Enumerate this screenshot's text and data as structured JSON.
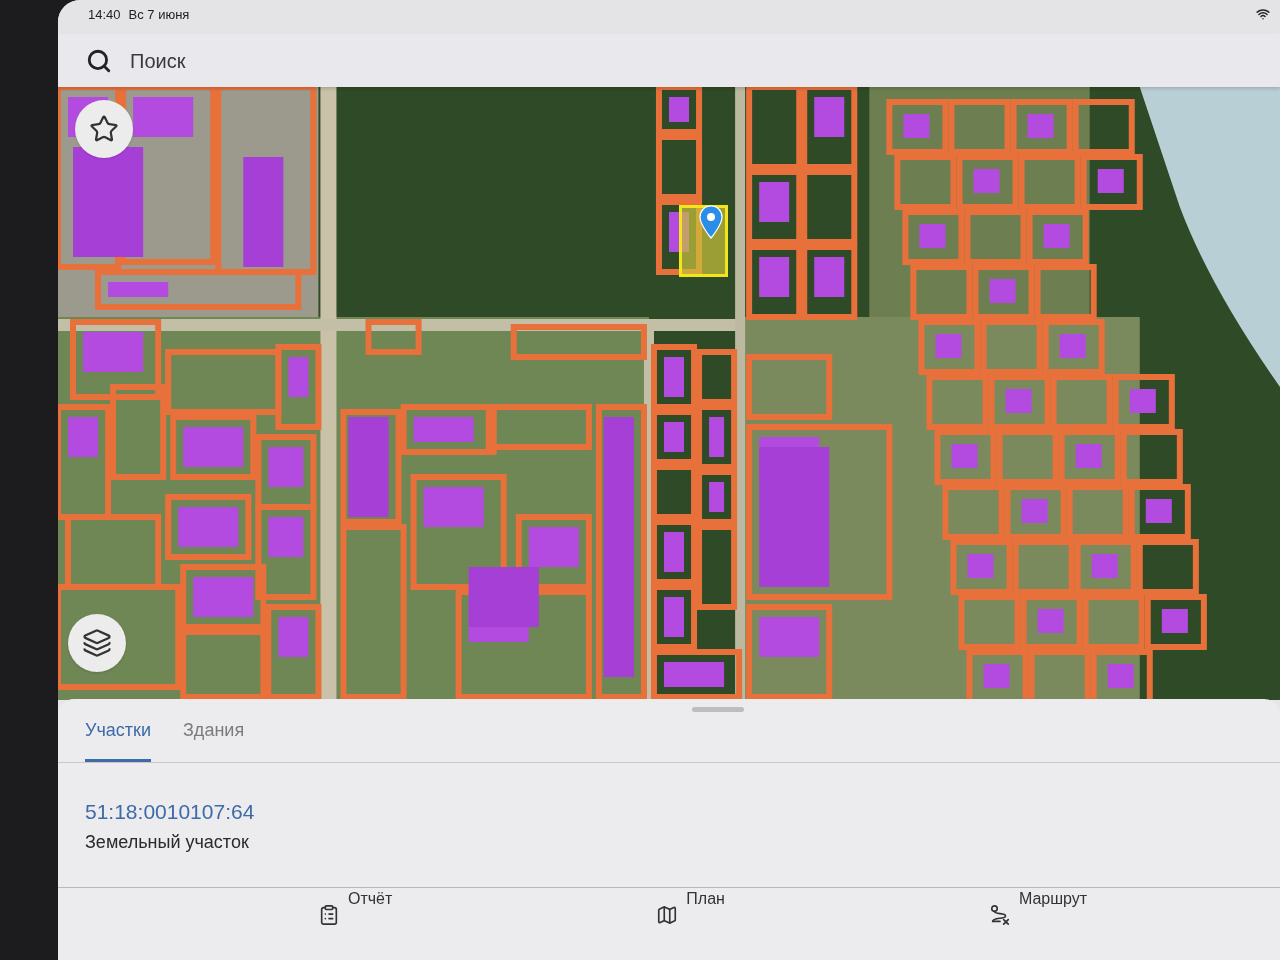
{
  "status_bar": {
    "time": "14:40",
    "date": "Вс 7 июня"
  },
  "search": {
    "placeholder": "Поиск"
  },
  "sheet": {
    "tabs": [
      {
        "label": "Участки",
        "selected": true
      },
      {
        "label": "Здания",
        "selected": false
      }
    ],
    "results": [
      {
        "number": "51:18:0010107:64",
        "type": "Земельный участок"
      }
    ]
  },
  "actions": [
    {
      "kind": "report",
      "label": "Отчёт"
    },
    {
      "kind": "plan",
      "label": "План"
    },
    {
      "kind": "route",
      "label": "Маршрут"
    }
  ]
}
